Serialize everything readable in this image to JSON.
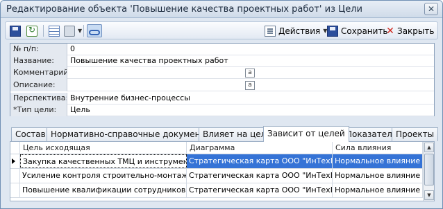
{
  "window": {
    "title": "Редактирование объекта 'Повышение качества проектных работ' из Цели",
    "close_glyph": "✕"
  },
  "toolbar": {
    "actions_label": "Действия",
    "save_label": "Сохранить",
    "close_label": "Закрыть",
    "close_glyph": "✕",
    "caret": "▼"
  },
  "properties": [
    {
      "label": "№ п/п:",
      "value": "0"
    },
    {
      "label": "Название:",
      "value": "Повышение качества проектных работ"
    },
    {
      "label": "Комментарий:",
      "value": ""
    },
    {
      "label": "Описание:",
      "value": ""
    },
    {
      "label": "Перспектива:",
      "value": "Внутренние бизнес-процессы"
    },
    {
      "label": "*Тип цели:",
      "value": "Цель"
    }
  ],
  "memo_glyph": "a",
  "tabs": [
    {
      "label": "Состав"
    },
    {
      "label": "Нормативно-справочные документы"
    },
    {
      "label": "Влияет на цели"
    },
    {
      "label": "Зависит от целей",
      "active": true
    },
    {
      "label": "Показатели"
    },
    {
      "label": "Проекты"
    }
  ],
  "grid": {
    "columns": [
      "Цель исходящая",
      "Диаграмма",
      "Сила влияния"
    ],
    "rows": [
      {
        "goal": "Закупка качественных ТМЦ и инструмента",
        "diagram": "Стратегическая карта ООО \"ИнТехП...",
        "strength": "Нормальное влияние",
        "selected": true
      },
      {
        "goal": "Усиление контроля строительно-монтажн...",
        "diagram": "Стратегическая карта ООО \"ИнТехП...",
        "strength": "Нормальное влияние"
      },
      {
        "goal": "Повышение квалификации сотрудников",
        "diagram": "Стратегическая карта ООО \"ИнТехП...",
        "strength": "Нормальное влияние"
      }
    ],
    "scroll_up": "▲",
    "scroll_down": "▼"
  }
}
